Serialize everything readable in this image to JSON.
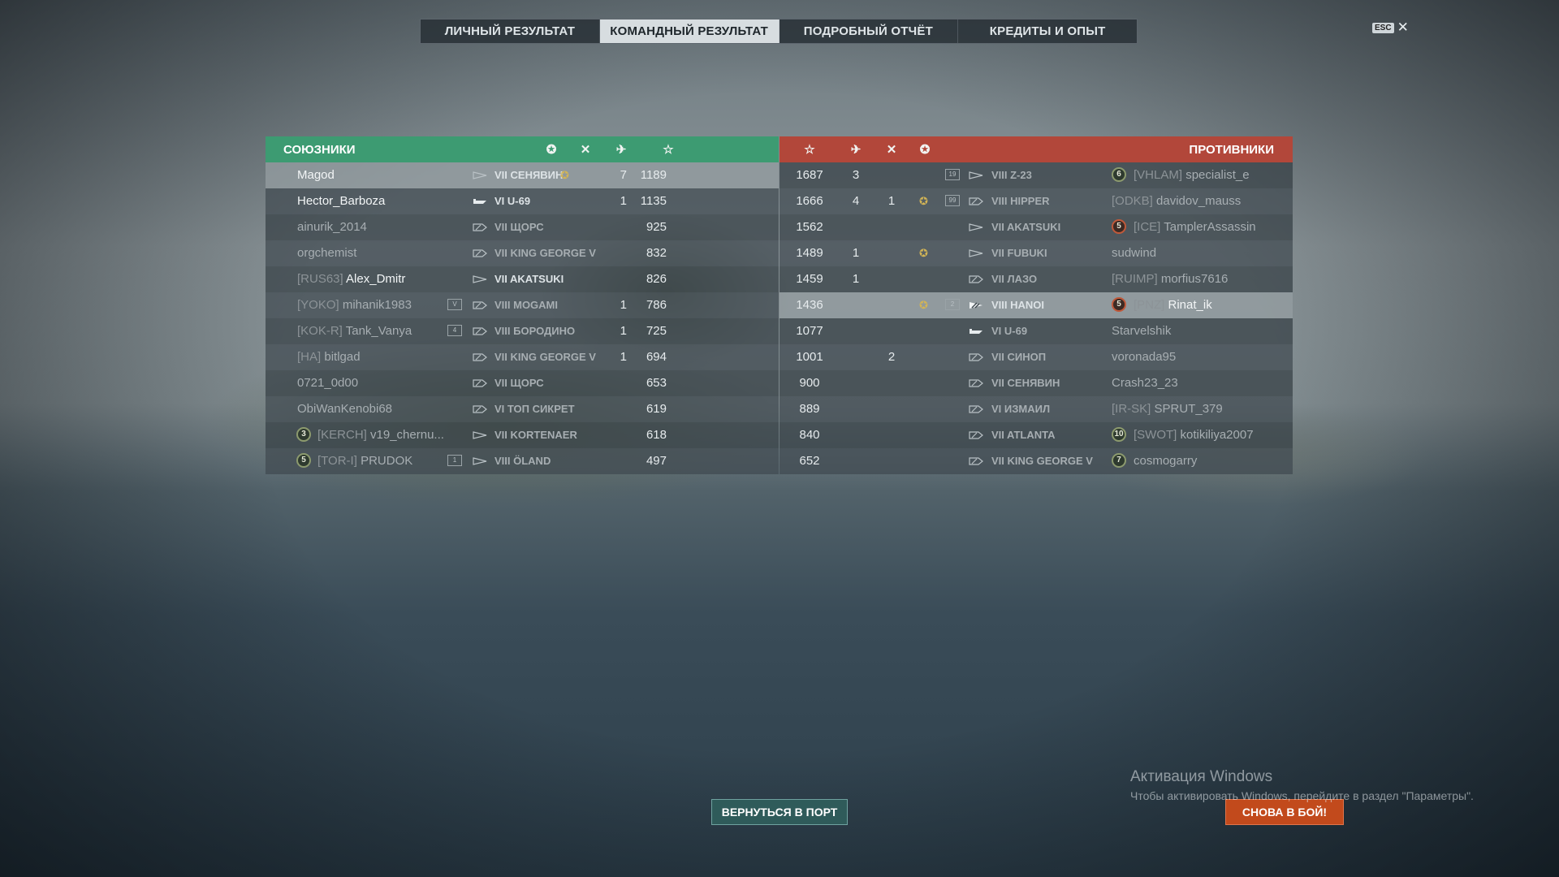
{
  "tabs": [
    "ЛИЧНЫЙ РЕЗУЛЬТАТ",
    "КОМАНДНЫЙ РЕЗУЛЬТАТ",
    "ПОДРОБНЫЙ ОТЧЁТ",
    "КРЕДИТЫ И ОПЫТ"
  ],
  "active_tab": 1,
  "esc": {
    "key": "ESC",
    "close": "✕"
  },
  "allies": {
    "title": "СОЮЗНИКИ",
    "header_icons": [
      "wreath-icon",
      "crossed-swords-icon",
      "plane-icon",
      "star-icon"
    ],
    "rows": [
      {
        "rank": "",
        "clan": "",
        "name": "Magod",
        "badge": "",
        "class": "destroyer",
        "ship": "VII СЕНЯВИН",
        "medal": true,
        "kills": "",
        "planes": "7",
        "score": "1189",
        "highlight": true
      },
      {
        "rank": "",
        "clan": "",
        "name": "Hector_Barboza",
        "badge": "",
        "class": "submarine",
        "ship": "VI U-69",
        "medal": false,
        "kills": "",
        "planes": "1",
        "score": "1135"
      },
      {
        "rank": "",
        "clan": "",
        "name": "ainurik_2014",
        "badge": "",
        "class": "battleship",
        "ship": "VII ЩОРС",
        "medal": false,
        "kills": "",
        "planes": "",
        "score": "925",
        "dead": true
      },
      {
        "rank": "",
        "clan": "",
        "name": "orgchemist",
        "badge": "",
        "class": "battleship",
        "ship": "VII KING GEORGE V",
        "medal": false,
        "kills": "",
        "planes": "",
        "score": "832",
        "dead": true
      },
      {
        "rank": "",
        "clan": "[RUS63]",
        "name": "Alex_Dmitr",
        "badge": "",
        "class": "destroyer",
        "ship": "VII AKATSUKI",
        "medal": false,
        "kills": "",
        "planes": "",
        "score": "826"
      },
      {
        "rank": "",
        "clan": "[YOKO]",
        "name": "mihanik1983",
        "badge": "V",
        "class": "battleship",
        "ship": "VIII MOGAMI",
        "medal": false,
        "kills": "",
        "planes": "1",
        "score": "786",
        "dead": true
      },
      {
        "rank": "",
        "clan": "[KOK-R]",
        "name": "Tank_Vanya",
        "badge": "4",
        "class": "battleship",
        "ship": "VIII БОРОДИНО",
        "medal": false,
        "kills": "",
        "planes": "1",
        "score": "725",
        "dead": true
      },
      {
        "rank": "",
        "clan": "[HA]",
        "name": "bitlgad",
        "badge": "",
        "class": "battleship",
        "ship": "VII KING GEORGE V",
        "medal": false,
        "kills": "",
        "planes": "1",
        "score": "694",
        "dead": true
      },
      {
        "rank": "",
        "clan": "",
        "name": "0721_0d00",
        "badge": "",
        "class": "battleship",
        "ship": "VII ЩОРС",
        "medal": false,
        "kills": "",
        "planes": "",
        "score": "653",
        "dead": true
      },
      {
        "rank": "",
        "clan": "",
        "name": "ObiWanKenobi68",
        "badge": "",
        "class": "battleship",
        "ship": "VI ТОП СИКРЕТ",
        "medal": false,
        "kills": "",
        "planes": "",
        "score": "619",
        "dead": true
      },
      {
        "rank": "3",
        "clan": "[KERCH]",
        "name": "v19_chernu...",
        "badge": "",
        "class": "destroyer",
        "ship": "VII KORTENAER",
        "medal": false,
        "kills": "",
        "planes": "",
        "score": "618",
        "dead": true
      },
      {
        "rank": "5",
        "clan": "[TOR-I]",
        "name": "PRUDOK",
        "badge": "1",
        "class": "destroyer",
        "ship": "VIII ÖLAND",
        "medal": false,
        "kills": "",
        "planes": "",
        "score": "497",
        "dead": true
      }
    ]
  },
  "enemies": {
    "title": "ПРОТИВНИКИ",
    "header_icons": [
      "star-icon",
      "plane-icon",
      "crossed-swords-icon",
      "wreath-icon"
    ],
    "rows": [
      {
        "score": "1687",
        "planes": "3",
        "kills": "",
        "medal": false,
        "badge": "19",
        "class": "destroyer",
        "ship": "VIII Z-23",
        "rank": "6",
        "clan": "[VHLAM]",
        "name": "specialist_e",
        "dead": true
      },
      {
        "score": "1666",
        "planes": "4",
        "kills": "1",
        "medal": true,
        "badge": "99",
        "class": "battleship",
        "ship": "VIII HIPPER",
        "rank": "",
        "clan": "[ODKB]",
        "name": "davidov_mauss",
        "dead": true
      },
      {
        "score": "1562",
        "planes": "",
        "kills": "",
        "medal": false,
        "badge": "",
        "class": "destroyer",
        "ship": "VII AKATSUKI",
        "rank": "5",
        "clan": "[ICE]",
        "name": "TamplerAssassin",
        "dead": true,
        "rank_red": true
      },
      {
        "score": "1489",
        "planes": "1",
        "kills": "",
        "medal": true,
        "badge": "",
        "class": "destroyer",
        "ship": "VII FUBUKI",
        "rank": "",
        "clan": "",
        "name": "sudwind",
        "dead": true
      },
      {
        "score": "1459",
        "planes": "1",
        "kills": "",
        "medal": false,
        "badge": "",
        "class": "battleship",
        "ship": "VII ЛАЗО",
        "rank": "",
        "clan": "[RUIMP]",
        "name": "morfius7616",
        "dead": true
      },
      {
        "score": "1436",
        "planes": "",
        "kills": "",
        "medal": true,
        "badge": "2",
        "class": "destroyer-fast",
        "ship": "VIII HANOI",
        "rank": "5",
        "clan": "[PNZ]",
        "name": "Rinat_ik",
        "alive": true,
        "rank_red": true
      },
      {
        "score": "1077",
        "planes": "",
        "kills": "",
        "medal": false,
        "badge": "",
        "class": "submarine",
        "ship": "VI U-69",
        "rank": "",
        "clan": "",
        "name": "Starvelshik",
        "dead": true
      },
      {
        "score": "1001",
        "planes": "",
        "kills": "2",
        "medal": false,
        "badge": "",
        "class": "battleship",
        "ship": "VII СИНОП",
        "rank": "",
        "clan": "",
        "name": "voronada95",
        "dead": true
      },
      {
        "score": "900",
        "planes": "",
        "kills": "",
        "medal": false,
        "badge": "",
        "class": "battleship",
        "ship": "VII СЕНЯВИН",
        "rank": "",
        "clan": "",
        "name": "Crash23_23",
        "dead": true
      },
      {
        "score": "889",
        "planes": "",
        "kills": "",
        "medal": false,
        "badge": "",
        "class": "battleship",
        "ship": "VI ИЗМАИЛ",
        "rank": "",
        "clan": "[IR-SK]",
        "name": "SPRUT_379",
        "dead": true
      },
      {
        "score": "840",
        "planes": "",
        "kills": "",
        "medal": false,
        "badge": "",
        "class": "battleship",
        "ship": "VII ATLANTA",
        "rank": "10",
        "clan": "[SWOT]",
        "name": "kotikiliya2007",
        "dead": true
      },
      {
        "score": "652",
        "planes": "",
        "kills": "",
        "medal": false,
        "badge": "",
        "class": "battleship",
        "ship": "VII KING GEORGE V",
        "rank": "7",
        "clan": "",
        "name": "cosmogarry",
        "dead": true
      }
    ]
  },
  "buttons": {
    "port": "ВЕРНУТЬСЯ В ПОРТ",
    "battle": "СНОВА В БОЙ!"
  },
  "watermark": {
    "line1": "Активация Windows",
    "line2": "Чтобы активировать Windows, перейдите в раздел \"Параметры\"."
  },
  "colors": {
    "allies": "#3d9b72",
    "enemies": "#b2473a",
    "battle_button": "#c24a1c",
    "port_button": "#2f5b5a"
  }
}
